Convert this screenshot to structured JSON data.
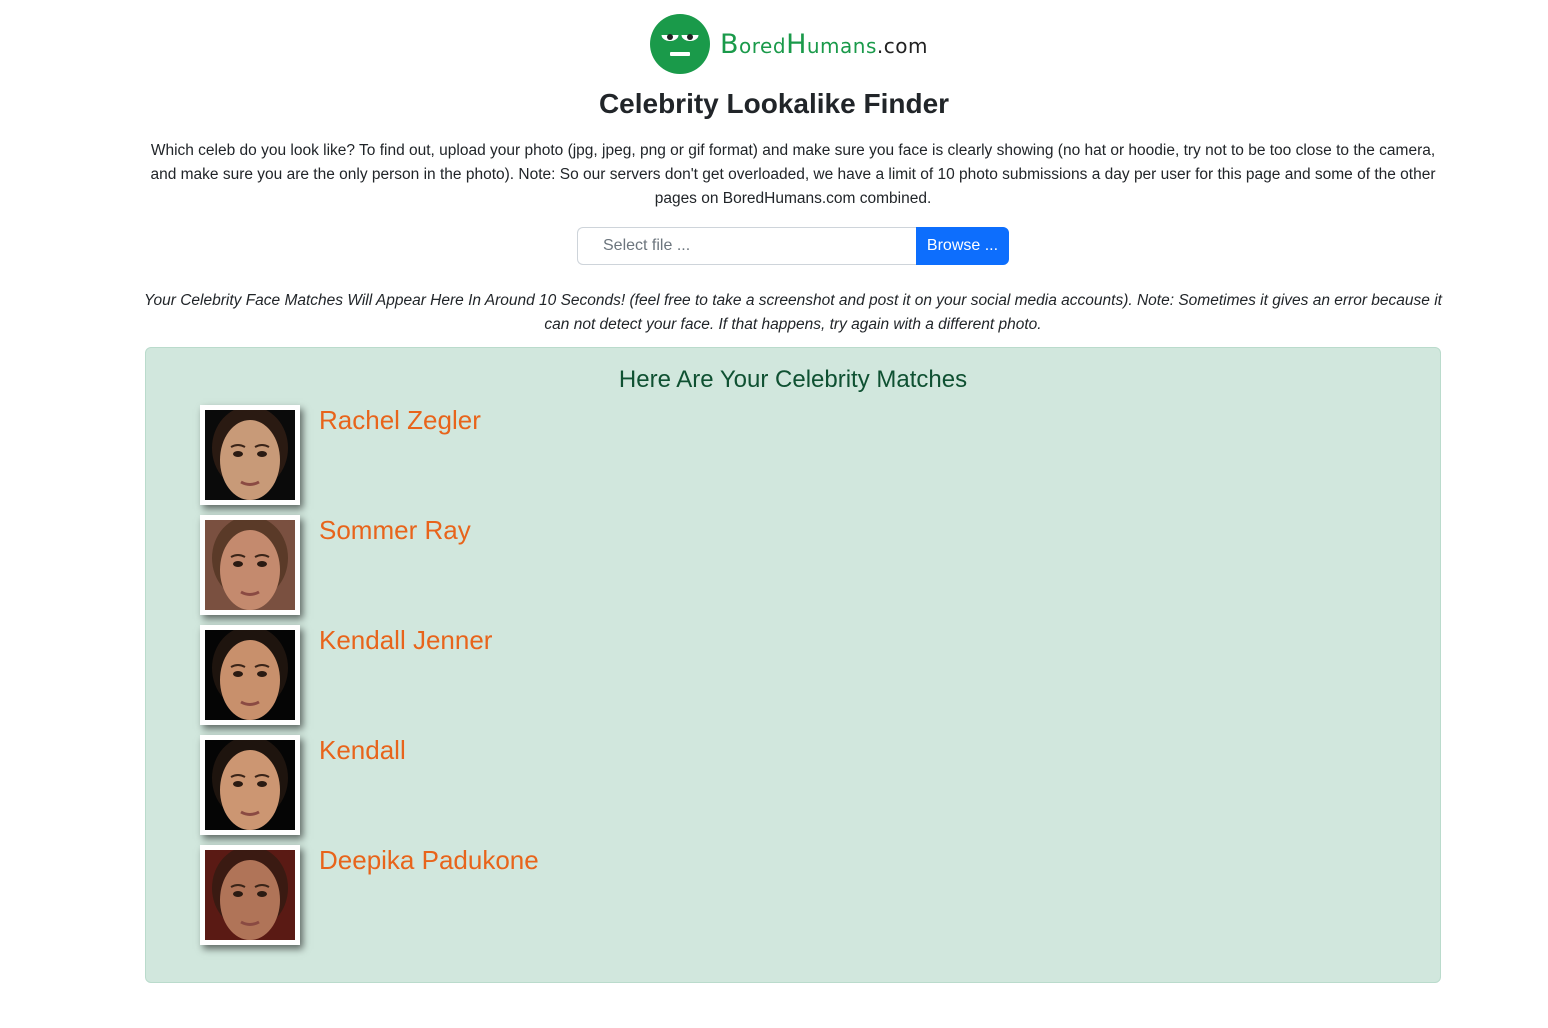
{
  "logo": {
    "brand_part1_initial": "B",
    "brand_part1_rest": "ored",
    "brand_part2_initial": "H",
    "brand_part2_rest": "umans",
    "brand_tld": ".com",
    "color": "#1a9a4a",
    "icon": "bored-face-icon"
  },
  "title": "Celebrity Lookalike Finder",
  "intro": "Which celeb do you look like? To find out, upload your photo (jpg, jpeg, png or gif format) and make sure you face is clearly showing (no hat or hoodie, try not to be too close to the camera, and make sure you are the only person in the photo). Note: So our servers don't get overloaded, we have a limit of 10 photo submissions a day per user for this page and some of the other pages on BoredHumans.com combined.",
  "upload": {
    "placeholder": "Select file ...",
    "browse_label": "Browse ..."
  },
  "note": "Your Celebrity Face Matches Will Appear Here In Around 10 Seconds! (feel free to take a screenshot and post it on your social media accounts). Note: Sometimes it gives an error because it can not detect your face. If that happens, try again with a different photo.",
  "results": {
    "heading": "Here Are Your Celebrity Matches",
    "matches": [
      {
        "name": "Rachel Zegler",
        "skin": "#c89a78",
        "hair": "#2a1a12",
        "bg": "#0a0a0a"
      },
      {
        "name": "Sommer Ray",
        "skin": "#c48a6e",
        "hair": "#5a3a28",
        "bg": "#7a5040"
      },
      {
        "name": "Kendall Jenner",
        "skin": "#c8906c",
        "hair": "#1e140e",
        "bg": "#050505"
      },
      {
        "name": "Kendall",
        "skin": "#cc9672",
        "hair": "#1e140e",
        "bg": "#050505"
      },
      {
        "name": "Deepika Padukone",
        "skin": "#b07458",
        "hair": "#3a1a12",
        "bg": "#5a1a14"
      }
    ],
    "name_color": "#e8641b",
    "panel_color": "#d1e7dd"
  }
}
